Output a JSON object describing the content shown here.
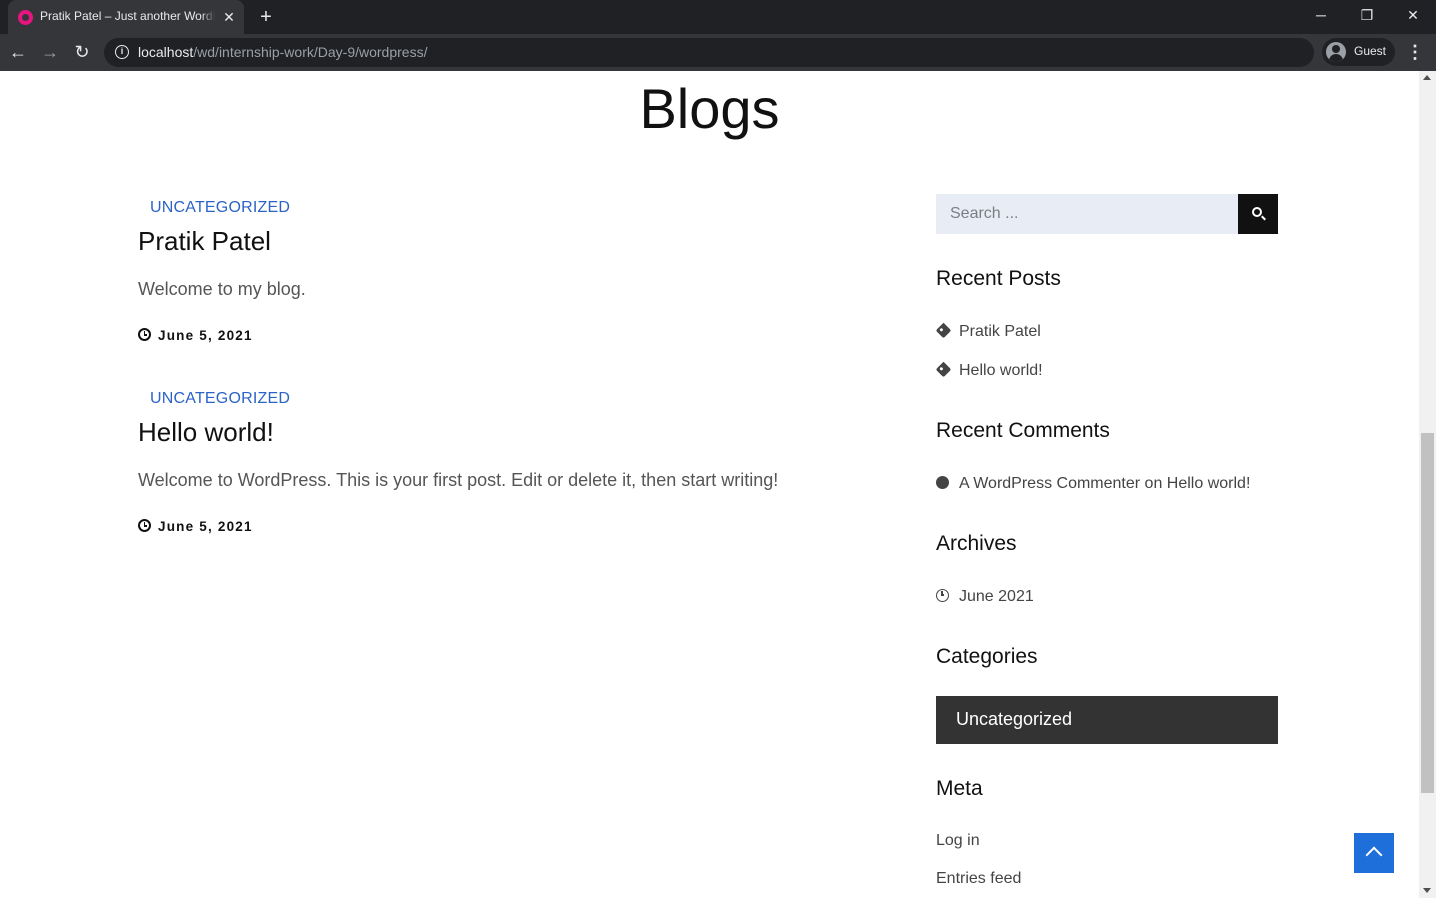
{
  "browser": {
    "tab_title": "Pratik Patel – Just another WordPress site",
    "tab_close": "✕",
    "new_tab": "+",
    "url_host": "localhost",
    "url_path": "/wd/internship-work/Day-9/wordpress/",
    "profile_label": "Guest",
    "icons": {
      "back": "←",
      "forward": "→",
      "reload": "↻",
      "menu": "⋮",
      "minimize": "─",
      "restore": "❐",
      "close": "✕"
    }
  },
  "page": {
    "heading": "Blogs"
  },
  "posts": [
    {
      "category": "UNCATEGORIZED",
      "title": "Pratik Patel",
      "excerpt": "Welcome to my blog.",
      "date": "June 5, 2021"
    },
    {
      "category": "UNCATEGORIZED",
      "title": "Hello world!",
      "excerpt": "Welcome to WordPress. This is your first post. Edit or delete it, then start writing!",
      "date": "June 5, 2021"
    }
  ],
  "sidebar": {
    "search_placeholder": "Search ...",
    "recent_posts": {
      "title": "Recent Posts",
      "items": [
        "Pratik Patel",
        "Hello world!"
      ]
    },
    "recent_comments": {
      "title": "Recent Comments",
      "author": "A WordPress Commenter",
      "connector": "on",
      "post": "Hello world!"
    },
    "archives": {
      "title": "Archives",
      "items": [
        "June 2021"
      ]
    },
    "categories": {
      "title": "Categories",
      "items": [
        "Uncategorized"
      ]
    },
    "meta": {
      "title": "Meta",
      "items": [
        "Log in",
        "Entries feed"
      ]
    }
  },
  "colors": {
    "category_link": "#2b63c7",
    "category_box": "#333333",
    "back_to_top": "#1e6fd9"
  }
}
